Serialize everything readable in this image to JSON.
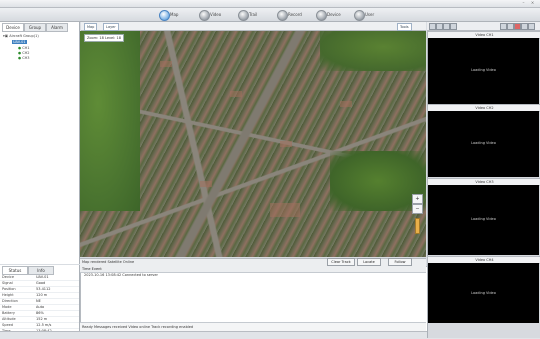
{
  "nav": {
    "buttons": [
      {
        "label": "Map",
        "active": true
      },
      {
        "label": "Video",
        "active": false
      },
      {
        "label": "Trail",
        "active": false
      },
      {
        "label": "Record",
        "active": false
      },
      {
        "label": "Device",
        "active": false
      },
      {
        "label": "User",
        "active": false
      }
    ]
  },
  "left_panel": {
    "tabs": [
      "Device",
      "Group",
      "Alarm"
    ],
    "tree": [
      "Aircraft Group(1)",
      "UAV-01",
      "CH1",
      "CH2",
      "CH3"
    ]
  },
  "map": {
    "toolbar": [
      "Map",
      "Layer",
      "Tools"
    ],
    "info": "Zoom: 18 Level: 18",
    "zoom_in": "+",
    "zoom_out": "−",
    "status": "Map rendered  Satellite  Online",
    "buttons": [
      "Clear Track",
      "Locate",
      "Follow"
    ]
  },
  "properties": {
    "tabs": [
      "Status",
      "Info"
    ],
    "rows": [
      {
        "key": "Device",
        "value": "UAV-01"
      },
      {
        "key": "Signal",
        "value": "Good"
      },
      {
        "key": "Position",
        "value": "53.4112"
      },
      {
        "key": "Height",
        "value": "120 m"
      },
      {
        "key": "Direction",
        "value": "NE"
      },
      {
        "key": "Mode",
        "value": "Auto"
      },
      {
        "key": "Battery",
        "value": "86%"
      },
      {
        "key": "Altitude",
        "value": "152 m"
      },
      {
        "key": "Speed",
        "value": "12.5 m/s"
      },
      {
        "key": "Time",
        "value": "13:08:42"
      }
    ]
  },
  "log": {
    "header": "Time        Event",
    "line": "2023-10-16 13:08:42  Connected to server",
    "status": "Ready  Messages received  Video online  Track recording enabled"
  },
  "videos": [
    {
      "title": "Video CH1",
      "text": "Loading Video"
    },
    {
      "title": "Video CH2",
      "text": "Loading Video"
    },
    {
      "title": "Video CH3",
      "text": "Loading Video"
    },
    {
      "title": "Video CH4",
      "text": "Loading Video"
    }
  ],
  "colors": {
    "accent": "#3d7fc0",
    "slider": "#e8b04a"
  }
}
